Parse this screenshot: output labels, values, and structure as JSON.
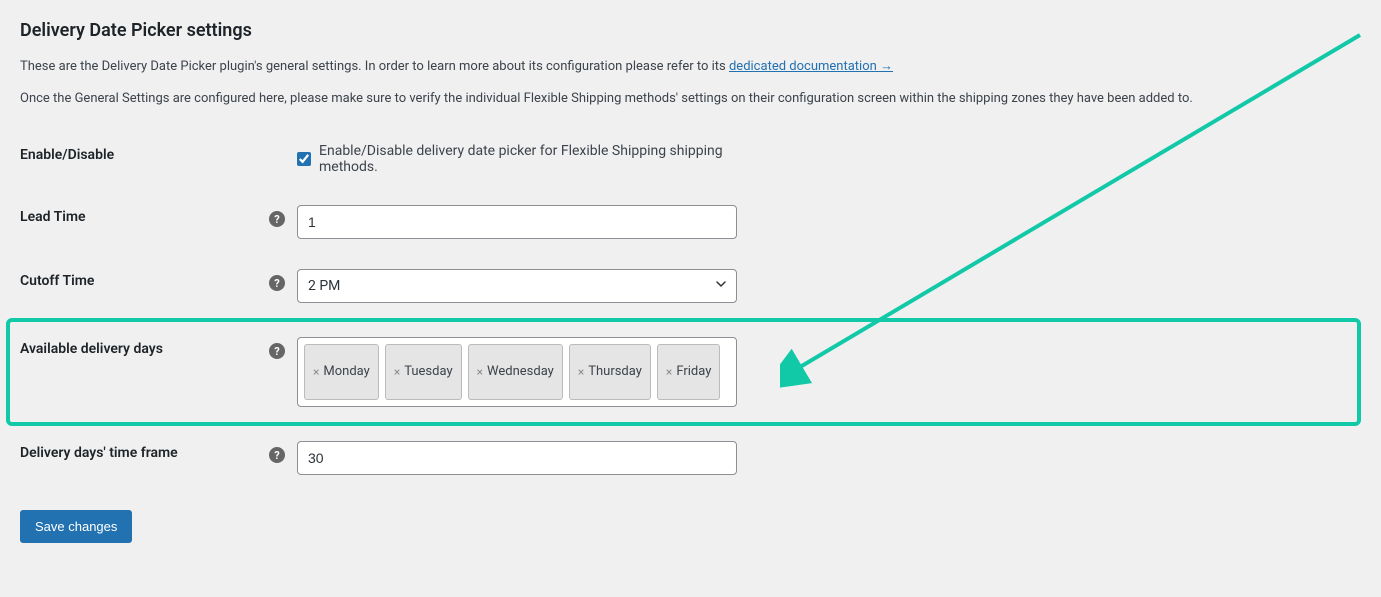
{
  "page": {
    "title": "Delivery Date Picker settings",
    "intro_prefix": "These are the Delivery Date Picker plugin's general settings. In order to learn more about its configuration please refer to its ",
    "doc_link_text": "dedicated documentation →",
    "intro2": "Once the General Settings are configured here, please make sure to verify the individual Flexible Shipping methods' settings on their configuration screen within the shipping zones they have been added to."
  },
  "fields": {
    "enable": {
      "label": "Enable/Disable",
      "checkbox_label": "Enable/Disable delivery date picker for Flexible Shipping shipping methods."
    },
    "lead_time": {
      "label": "Lead Time",
      "value": "1"
    },
    "cutoff_time": {
      "label": "Cutoff Time",
      "value": "2 PM"
    },
    "available_days": {
      "label": "Available delivery days",
      "tags": [
        "Monday",
        "Tuesday",
        "Wednesday",
        "Thursday",
        "Friday"
      ]
    },
    "time_frame": {
      "label": "Delivery days' time frame",
      "value": "30"
    }
  },
  "buttons": {
    "save": "Save changes"
  },
  "help_glyph": "?"
}
